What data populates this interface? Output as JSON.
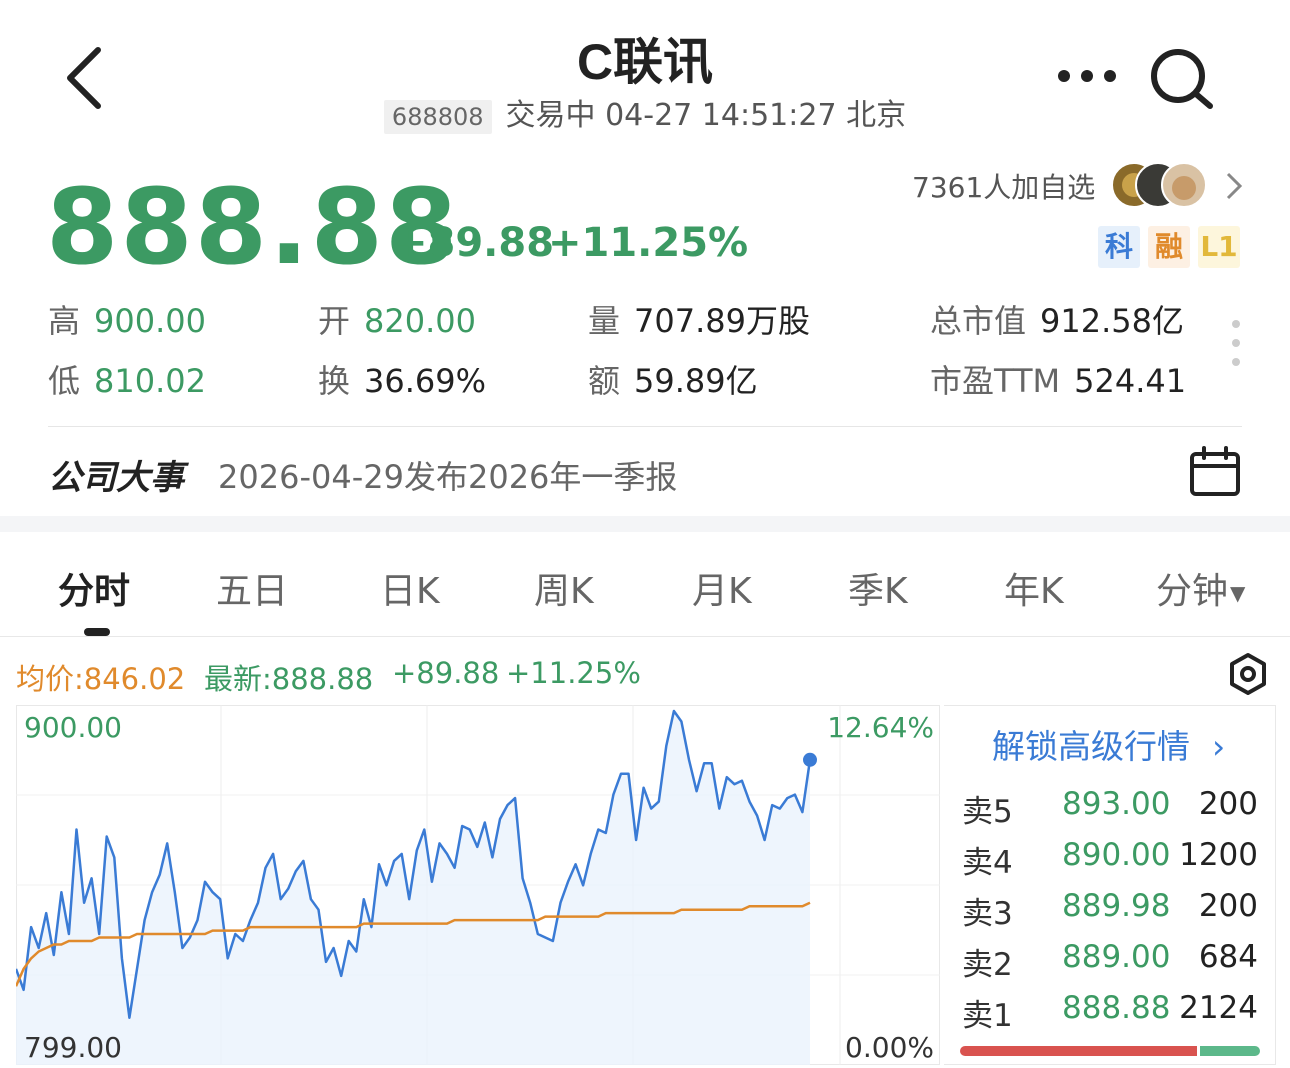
{
  "header": {
    "title": "C联讯",
    "code": "688808",
    "status_time": "交易中 04-27 14:51:27 北京"
  },
  "quote": {
    "price": "888.88",
    "change": "+89.88",
    "change_pct": "+11.25%",
    "watchers": "7361人加自选",
    "tags": [
      "科",
      "融",
      "L1"
    ],
    "stats": [
      {
        "label": "高",
        "value": "900.00"
      },
      {
        "label": "开",
        "value": "820.00"
      },
      {
        "label": "量",
        "value": "707.89万股"
      },
      {
        "label": "总市值",
        "value": "912.58亿"
      },
      {
        "label": "低",
        "value": "810.02"
      },
      {
        "label": "换",
        "value": "36.69%"
      },
      {
        "label": "额",
        "value": "59.89亿"
      },
      {
        "label": "市盈TTM",
        "value": "524.41"
      }
    ]
  },
  "event": {
    "label": "公司大事",
    "text": "2026-04-29发布2026年一季报"
  },
  "tabs": [
    "分时",
    "五日",
    "日K",
    "周K",
    "月K",
    "季K",
    "年K",
    "分钟"
  ],
  "active_tab": "分时",
  "legend": {
    "avg": "均价:846.02",
    "latest": "最新:888.88",
    "change": "+89.88",
    "change_pct": "+11.25%"
  },
  "chart_data": {
    "type": "line",
    "y_max_label": "900.00",
    "y_min_label": "799.00",
    "pct_max_label": "12.64%",
    "pct_min_label": "0.00%",
    "ylim": [
      799.0,
      900.0
    ],
    "grid": true,
    "series": [
      {
        "values": [
          826,
          820,
          838,
          832,
          842,
          830,
          848,
          836,
          866,
          845,
          852,
          836,
          864,
          858,
          829,
          812,
          826,
          840,
          848,
          853,
          862,
          848,
          832,
          835,
          840,
          851,
          848,
          846,
          829,
          836,
          834,
          840,
          845,
          855,
          859,
          846,
          849,
          854,
          857,
          846,
          843,
          828,
          832,
          824,
          834,
          831,
          846,
          838,
          856,
          850,
          857,
          859,
          846,
          860,
          866,
          851,
          862,
          859,
          855,
          867,
          866,
          861,
          868,
          858,
          869,
          873,
          875,
          852,
          845,
          836,
          835,
          834,
          845,
          851,
          856,
          850,
          859,
          866,
          865,
          876,
          882,
          882,
          863,
          878,
          872,
          874,
          890,
          900,
          897,
          886,
          877,
          885,
          885,
          872,
          881,
          879,
          880,
          874,
          870,
          863,
          873,
          872,
          875,
          876,
          871,
          886
        ]
      },
      {
        "color": "#e08a2c",
        "values": [
          821,
          826,
          829,
          831,
          832,
          833,
          833,
          834,
          834,
          834,
          834,
          835,
          835,
          835,
          835,
          835,
          836,
          836,
          836,
          836,
          836,
          836,
          836,
          836,
          836,
          836,
          837,
          837,
          837,
          837,
          837,
          838,
          838,
          838,
          838,
          838,
          838,
          838,
          838,
          838,
          838,
          838,
          838,
          838,
          838,
          838,
          839,
          839,
          839,
          839,
          839,
          839,
          839,
          839,
          839,
          839,
          839,
          839,
          840,
          840,
          840,
          840,
          840,
          840,
          840,
          840,
          840,
          840,
          840,
          840,
          841,
          841,
          841,
          841,
          841,
          841,
          841,
          841,
          842,
          842,
          842,
          842,
          842,
          842,
          842,
          842,
          842,
          842,
          843,
          843,
          843,
          843,
          843,
          843,
          843,
          843,
          843,
          844,
          844,
          844,
          844,
          844,
          844,
          844,
          844,
          845
        ]
      }
    ]
  },
  "order_book": {
    "unlock_label": "解锁高级行情",
    "asks": [
      {
        "side": "卖5",
        "price": "893.00",
        "volume": "200"
      },
      {
        "side": "卖4",
        "price": "890.00",
        "volume": "1200"
      },
      {
        "side": "卖3",
        "price": "889.98",
        "volume": "200"
      },
      {
        "side": "卖2",
        "price": "889.00",
        "volume": "684"
      },
      {
        "side": "卖1",
        "price": "888.88",
        "volume": "2124"
      }
    ],
    "ratio_sell": 0.79,
    "colors": {
      "sell": "#d9534f",
      "buy": "#5cb88a"
    }
  }
}
